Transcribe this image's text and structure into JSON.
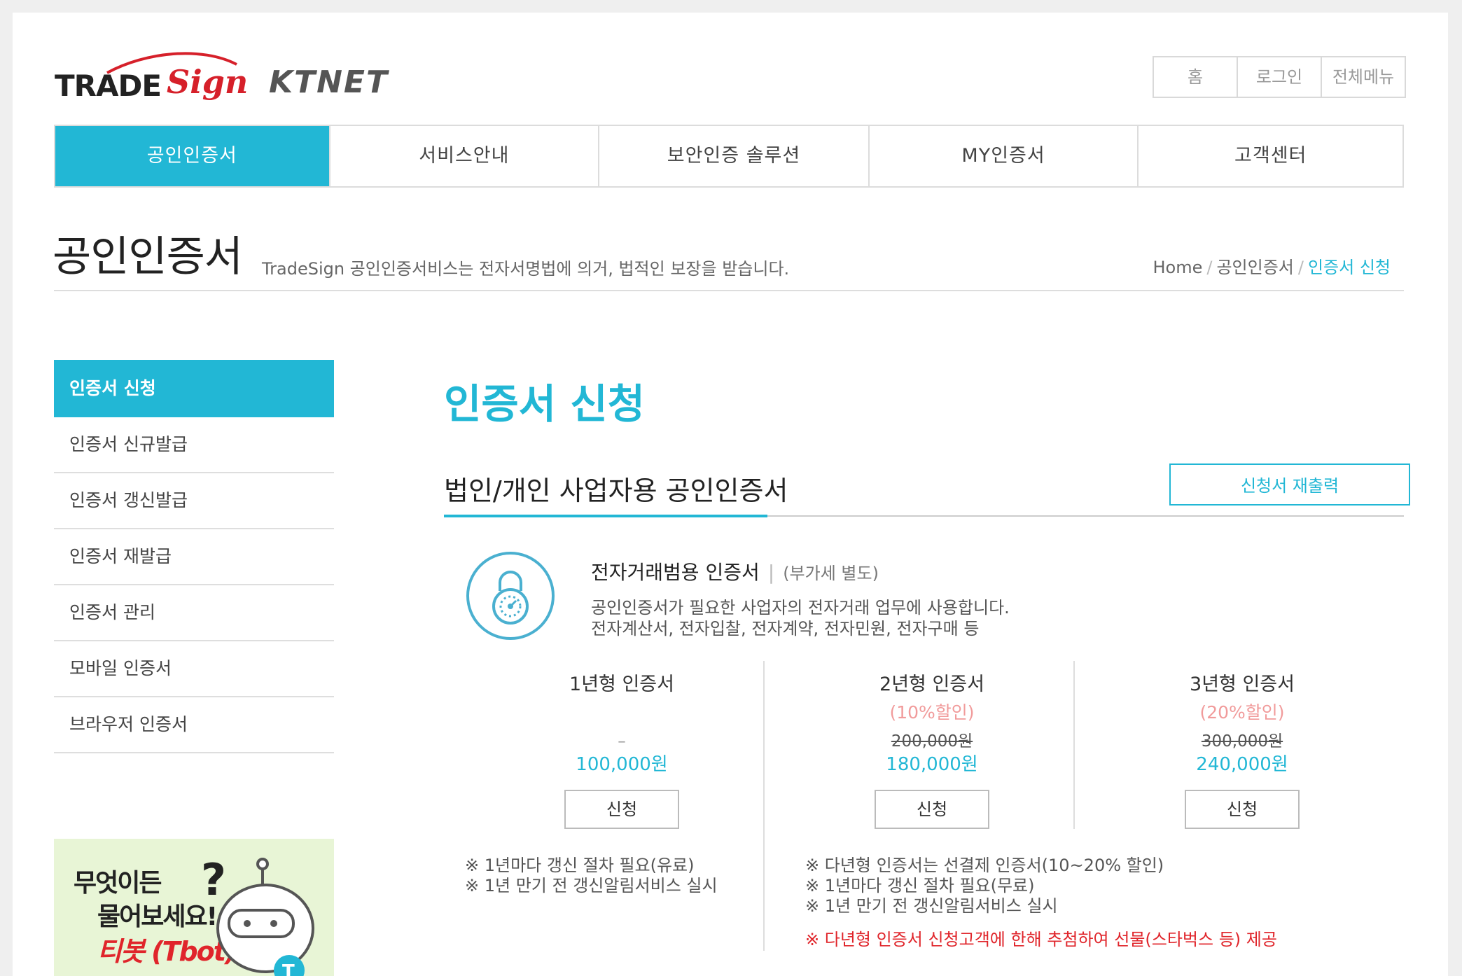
{
  "header": {
    "logo_trade": "TRADE",
    "logo_sign": "Sign",
    "logo_ktnet": "KTNET",
    "util": [
      "홈",
      "로그인",
      "전체메뉴"
    ]
  },
  "gnb": [
    "공인인증서",
    "서비스안내",
    "보안인증 솔루션",
    "MY인증서",
    "고객센터"
  ],
  "page_head": {
    "title": "공인인증서",
    "desc": "TradeSign 공인인증서비스는 전자서명법에 의거, 법적인 보장을 받습니다.",
    "breadcrumb": [
      "Home",
      "공인인증서",
      "인증서 신청"
    ]
  },
  "lnb": {
    "head": "인증서 신청",
    "items": [
      "인증서 신규발급",
      "인증서 갱신발급",
      "인증서 재발급",
      "인증서 관리",
      "모바일 인증서",
      "브라우저 인증서"
    ]
  },
  "banner": {
    "line1": "무엇이든",
    "line2": "물어보세요!",
    "line3": "티봇 (Tbot)"
  },
  "content": {
    "title": "인증서 신청",
    "subtitle": "법인/개인 사업자용 공인인증서",
    "reprint_button": "신청서 재출력",
    "product_name": "전자거래범용 인증서",
    "vat_note": "(부가세 별도)",
    "desc1": "공인인증서가 필요한 사업자의 전자거래 업무에 사용합니다.",
    "desc2": "전자계산서, 전자입찰, 전자계약, 전자민원, 전자구매 등",
    "plans": [
      {
        "name": "1년형 인증서",
        "discount": "",
        "original": "–",
        "price": "100,000원",
        "button": "신청"
      },
      {
        "name": "2년형 인증서",
        "discount": "(10%할인)",
        "original": "200,000원",
        "price": "180,000원",
        "button": "신청"
      },
      {
        "name": "3년형 인증서",
        "discount": "(20%할인)",
        "original": "300,000원",
        "price": "240,000원",
        "button": "신청"
      }
    ],
    "notes_left": [
      "※ 1년마다 갱신 절차 필요(유료)",
      "※ 1년 만기 전 갱신알림서비스 실시"
    ],
    "notes_right": [
      "※ 다년형 인증서는 선결제 인증서(10~20% 할인)",
      "※ 1년마다 갱신 절차 필요(무료)",
      "※ 1년 만기 전 갱신알림서비스 실시"
    ],
    "note_red": "※ 다년형 인증서 신청고객에 한해 추첨하여 선물(스타벅스 등) 제공"
  },
  "colors": {
    "accent": "#22b7d5",
    "discount": "#f19b9b",
    "alert": "#e0252b"
  }
}
